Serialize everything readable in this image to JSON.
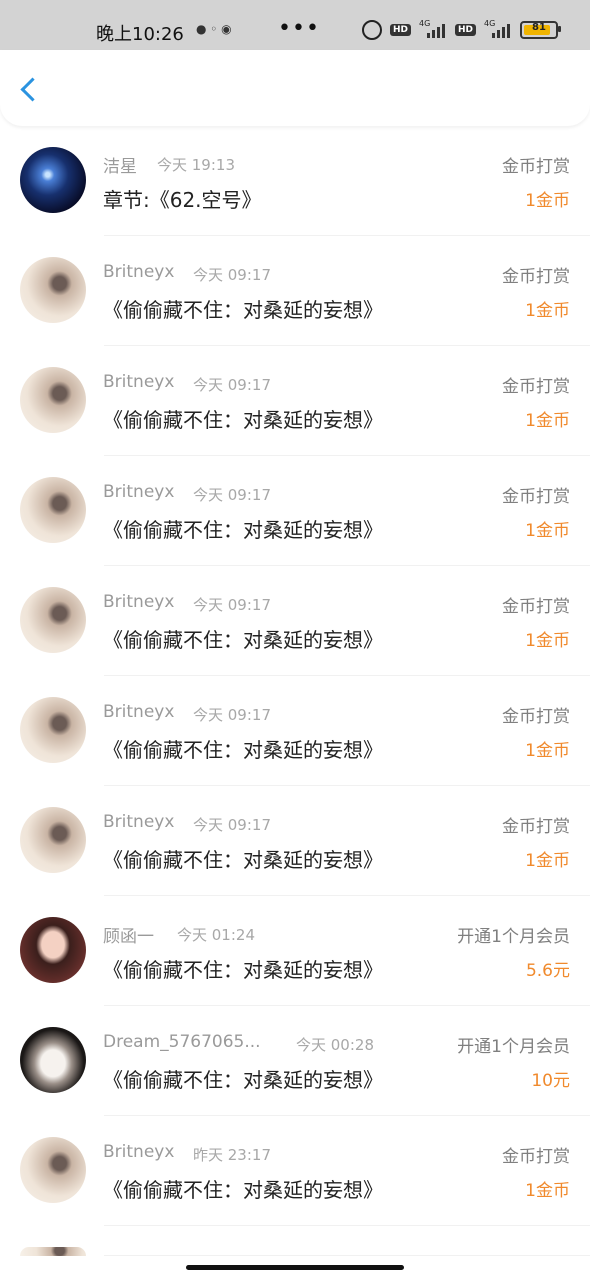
{
  "status_bar": {
    "time": "晚上10:26",
    "battery": "81",
    "signal_label": "4G",
    "hd_label": "HD"
  },
  "header": {
    "back_icon": "chevron-left-icon"
  },
  "rows": [
    {
      "name": "洁星",
      "time": "今天 19:13",
      "title": "章节:《62.空号》",
      "type": "金币打赏",
      "amount": "1金币"
    },
    {
      "name": "Britneyx",
      "time": "今天 09:17",
      "title": "《偷偷藏不住：对桑延的妄想》",
      "type": "金币打赏",
      "amount": "1金币"
    },
    {
      "name": "Britneyx",
      "time": "今天 09:17",
      "title": "《偷偷藏不住：对桑延的妄想》",
      "type": "金币打赏",
      "amount": "1金币"
    },
    {
      "name": "Britneyx",
      "time": "今天 09:17",
      "title": "《偷偷藏不住：对桑延的妄想》",
      "type": "金币打赏",
      "amount": "1金币"
    },
    {
      "name": "Britneyx",
      "time": "今天 09:17",
      "title": "《偷偷藏不住：对桑延的妄想》",
      "type": "金币打赏",
      "amount": "1金币"
    },
    {
      "name": "Britneyx",
      "time": "今天 09:17",
      "title": "《偷偷藏不住：对桑延的妄想》",
      "type": "金币打赏",
      "amount": "1金币"
    },
    {
      "name": "Britneyx",
      "time": "今天 09:17",
      "title": "《偷偷藏不住：对桑延的妄想》",
      "type": "金币打赏",
      "amount": "1金币"
    },
    {
      "name": "顾函一",
      "time": "今天 01:24",
      "title": "《偷偷藏不住：对桑延的妄想》",
      "type": "开通1个月会员",
      "amount": "5.6元"
    },
    {
      "name": "Dream_5767065...",
      "time": "今天 00:28",
      "title": "《偷偷藏不住：对桑延的妄想》",
      "type": "开通1个月会员",
      "amount": "10元"
    },
    {
      "name": "Britneyx",
      "time": "昨天 23:17",
      "title": "《偷偷藏不住：对桑延的妄想》",
      "type": "金币打赏",
      "amount": "1金币"
    }
  ],
  "colors": {
    "accent_blue": "#2b93e0",
    "amount_orange": "#f08a2d"
  }
}
